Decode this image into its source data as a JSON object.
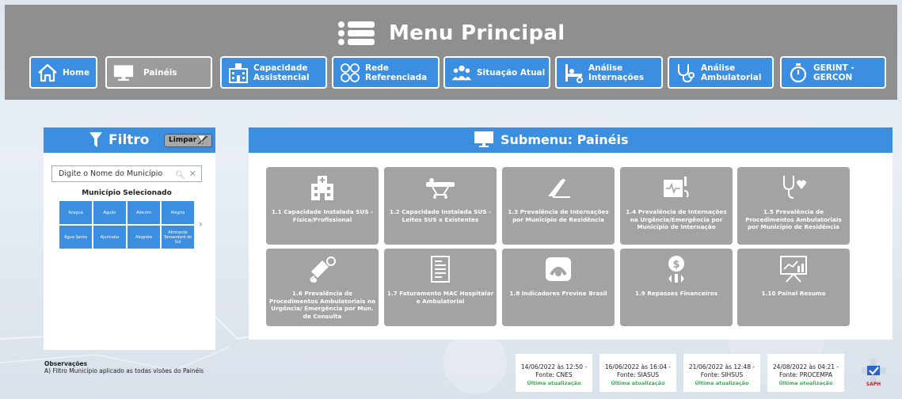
{
  "header": {
    "title": "Menu Principal",
    "nav": [
      {
        "label": "Home",
        "icon": "home-icon",
        "active": false
      },
      {
        "label": "Painéis",
        "icon": "monitor-icon",
        "active": true
      },
      {
        "label": "Capacidade\nAssistencial",
        "icon": "hospital-icon",
        "active": false
      },
      {
        "label": "Rede\nReferenciada",
        "icon": "network-icon",
        "active": false
      },
      {
        "label": "Situação Atual",
        "icon": "people-group-icon",
        "active": false
      },
      {
        "label": "Análise\nInternações",
        "icon": "hospital-bed-icon",
        "active": false
      },
      {
        "label": "Análise\nAmbulatorial",
        "icon": "stethoscope-icon",
        "active": false
      },
      {
        "label": "GERINT -\nGERCON",
        "icon": "stopwatch-icon",
        "active": false
      }
    ]
  },
  "filter": {
    "title": "Filtro",
    "clear_label": "Limpar",
    "search_placeholder": "Digite o Nome do Município",
    "selected_label": "Município Selecionado",
    "municipios": [
      "Aceguá",
      "Agudo",
      "Alecrim",
      "Alegria",
      "Água Santa",
      "Ajuricaba",
      "Alegrete",
      "Almirante Tamandaré do Sul"
    ]
  },
  "submenu": {
    "title": "Submenu: Painéis",
    "tiles": [
      {
        "label": "1.1 Capacidade Instalada SUS - Física/Profissional",
        "icon": "hospital-icon"
      },
      {
        "label": "1.2 Capacidade Instalada SUS - Leitos SUS x Existentes",
        "icon": "stretcher-icon"
      },
      {
        "label": "1.3 Prevalência de Internações por Município de Residência",
        "icon": "scalpel-icon"
      },
      {
        "label": "1.4 Prevalência de Internações na Urgência/Emergência por Município de Internação",
        "icon": "monitor-device-icon"
      },
      {
        "label": "1.5 Prevalência de Procedimentos Ambulatoriais por Município de Residência",
        "icon": "stethoscope-heart-icon"
      },
      {
        "label": "1.6 Prevalência de Procedimentos Ambulatoriais na Urgência/ Emergência por Mun. de Consulta",
        "icon": "blood-pressure-icon"
      },
      {
        "label": "1.7 Faturamento MAC Hospitalar e Ambulatorial",
        "icon": "invoice-icon"
      },
      {
        "label": "1.8 Indicadores Previne Brasil",
        "icon": "previne-icon"
      },
      {
        "label": "1.9 Repasses Financeiros",
        "icon": "money-transfer-icon"
      },
      {
        "label": "1.10 Painel Resumo",
        "icon": "presentation-chart-icon"
      }
    ]
  },
  "observacoes": {
    "title": "Observações",
    "text": "A) Filtro Município aplicado as todas visões do Painéis"
  },
  "updates": [
    {
      "date": "14/06/2022 às 12:50  -",
      "source": "Fonte: CNES",
      "status": "Última atualização"
    },
    {
      "date": "16/06/2022 às 16:04  -",
      "source": "Fonte: SIASUS",
      "status": "Última atualização"
    },
    {
      "date": "21/06/2022 às 12:48  -",
      "source": "Fonte: SIHSUS",
      "status": "Última atualização"
    },
    {
      "date": "24/08/2022 às 04:21  -",
      "source": "Fonte: PROCEMPA",
      "status": "Última atualização"
    }
  ],
  "logo": {
    "text": "SAPH"
  },
  "colors": {
    "accent": "#3c8ee0",
    "header_bg": "#8f8f8f",
    "tile_bg": "#a3a3a3",
    "ok_green": "#2db34a"
  }
}
